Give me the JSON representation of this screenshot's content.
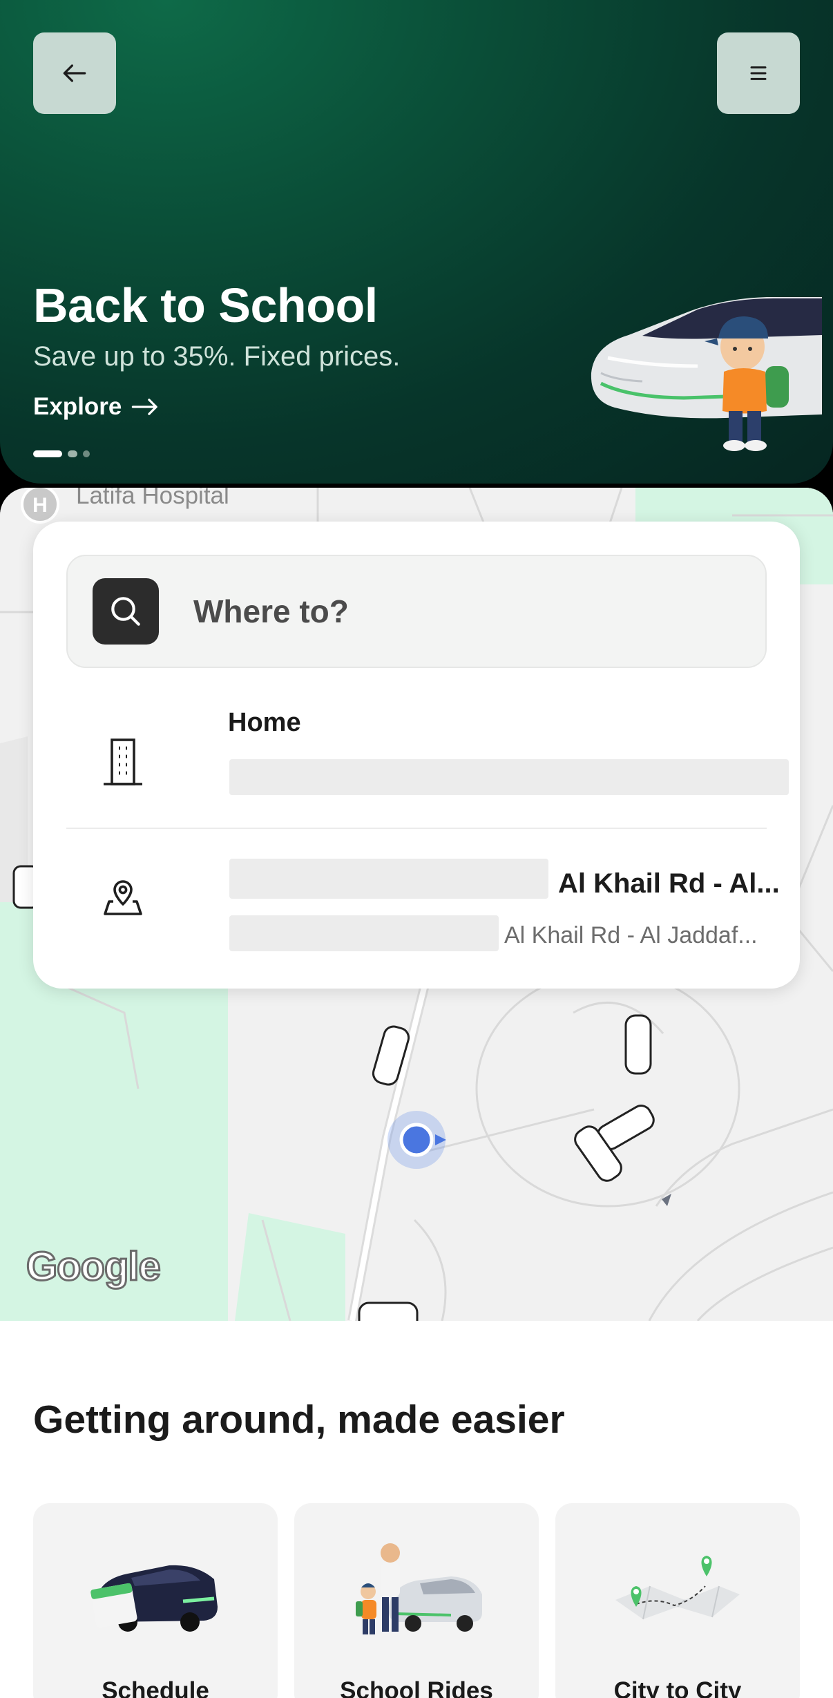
{
  "hero": {
    "title": "Back to School",
    "subtitle": "Save up to 35%. Fixed prices.",
    "link_label": "Explore",
    "carousel": {
      "total": 3,
      "active": 1
    },
    "colors": {
      "bg": "#0a4d37",
      "button": "#c7d9d2"
    }
  },
  "map": {
    "poi_label": "Latifa Hospital",
    "attribution": "Google"
  },
  "search": {
    "placeholder": "Where to?"
  },
  "places": {
    "home": {
      "title": "Home"
    },
    "recent": {
      "title": "Al Khail Rd - Al...",
      "subtitle": "Al Khail Rd - Al Jaddaf..."
    }
  },
  "services": {
    "title": "Getting around, made easier",
    "items": [
      {
        "label": "Schedule"
      },
      {
        "label": "School Rides"
      },
      {
        "label": "City to City"
      }
    ]
  }
}
